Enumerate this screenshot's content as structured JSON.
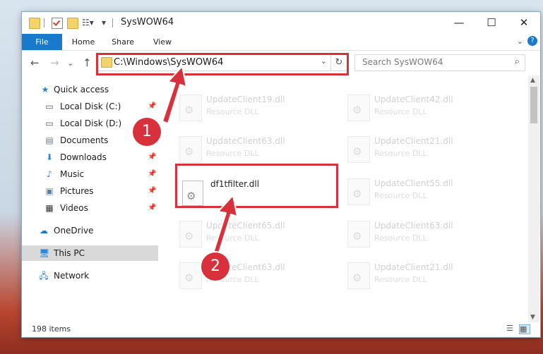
{
  "window": {
    "title": "SysWOW64",
    "controls": {
      "minimize": "—",
      "maximize": "☐",
      "close": "✕"
    }
  },
  "ribbon": {
    "tabs": [
      {
        "label": "File"
      },
      {
        "label": "Home"
      },
      {
        "label": "Share"
      },
      {
        "label": "View"
      }
    ],
    "collapse_glyph": "⌄",
    "help_glyph": "?"
  },
  "nav": {
    "back": "←",
    "forward": "→",
    "dropdown": "⌄",
    "up": "↑",
    "address": "C:\\Windows\\SysWOW64",
    "refresh_glyph": "↻",
    "search_placeholder": "Search SysWOW64"
  },
  "sidebar": {
    "items": [
      {
        "label": "Quick access",
        "icon": "star-icon"
      },
      {
        "label": "Local Disk (C:)",
        "icon": "drive-icon",
        "pinned": true
      },
      {
        "label": "Local Disk (D:)",
        "icon": "drive-icon"
      },
      {
        "label": "Documents",
        "icon": "documents-icon",
        "pinned": true
      },
      {
        "label": "Downloads",
        "icon": "download-icon",
        "pinned": true
      },
      {
        "label": "Music",
        "icon": "music-icon",
        "pinned": true
      },
      {
        "label": "Pictures",
        "icon": "pictures-icon",
        "pinned": true
      },
      {
        "label": "Videos",
        "icon": "videos-icon",
        "pinned": true
      },
      {
        "label": "OneDrive",
        "icon": "cloud-icon"
      },
      {
        "label": "This PC",
        "icon": "computer-icon",
        "selected": true
      },
      {
        "label": "Network",
        "icon": "network-icon"
      }
    ]
  },
  "files": {
    "highlighted": {
      "name": "df1tfilter.dll"
    },
    "left": [
      {
        "name": "UpdateClient19.dll",
        "type": "Resource DLL"
      },
      {
        "name": "UpdateClient63.dll",
        "type": "Resource DLL"
      },
      {
        "name": "UpdateClient65.dll",
        "type": "Resource DLL"
      },
      {
        "name": "UpdateClient63.dll",
        "type": "Resource DLL"
      }
    ],
    "right": [
      {
        "name": "UpdateClient42.dll",
        "type": "Resource DLL"
      },
      {
        "name": "UpdateClient21.dll",
        "type": "Resource DLL"
      },
      {
        "name": "UpdateClient55.dll",
        "type": "Resource DLL"
      },
      {
        "name": "UpdateClient63.dll",
        "type": "Resource DLL"
      },
      {
        "name": "UpdateClient21.dll",
        "type": "Resource DLL"
      }
    ]
  },
  "status": {
    "item_count": "198 items"
  },
  "annotations": {
    "step1": "1",
    "step2": "2",
    "color": "#d8313c"
  }
}
